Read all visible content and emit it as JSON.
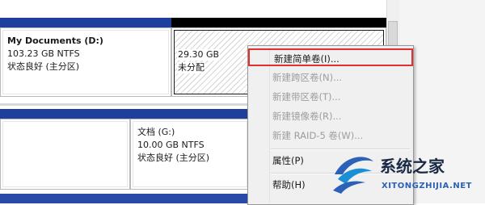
{
  "disks": {
    "top_row": [
      {
        "name": "My Documents  (D:)",
        "size": "103.23 GB NTFS",
        "status": "状态良好 (主分区)"
      },
      {
        "size": "29.30 GB",
        "status": "未分配"
      }
    ],
    "bottom_row": [
      {
        "name": "文档  (G:)",
        "size": "10.00 GB NTFS",
        "status": "状态良好 (主分区)"
      }
    ]
  },
  "context_menu": {
    "items": [
      {
        "label": "新建简单卷(I)...",
        "enabled": true,
        "highlighted": true
      },
      {
        "label": "新建跨区卷(N)...",
        "enabled": false
      },
      {
        "label": "新建带区卷(T)...",
        "enabled": false
      },
      {
        "label": "新建镜像卷(R)...",
        "enabled": false
      },
      {
        "label": "新建 RAID-5 卷(W)...",
        "enabled": false
      },
      {
        "label": "属性(P)",
        "enabled": true
      },
      {
        "label": "帮助(H)",
        "enabled": true
      }
    ]
  },
  "watermark": {
    "name": "系统之家",
    "url": "XITONGZHIJIA.NET"
  },
  "colors": {
    "partition_bar": "#1f3f9c",
    "unallocated_bar": "#000000",
    "highlight_border": "#e23030"
  }
}
